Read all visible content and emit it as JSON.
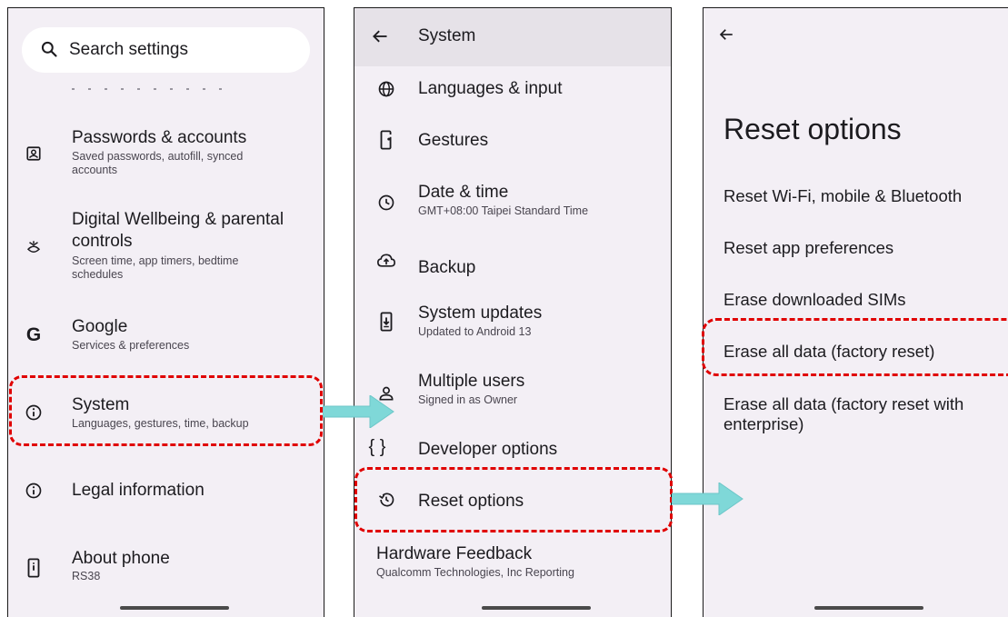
{
  "panel1": {
    "search_placeholder": "Search settings",
    "items": [
      {
        "title": "Passwords & accounts",
        "sub": "Saved passwords, autofill, synced",
        "sub2": "accounts",
        "icon": "account-box-icon"
      },
      {
        "title": "Digital Wellbeing & parental",
        "title2": "controls",
        "sub": "Screen time, app timers, bedtime",
        "sub2": "schedules",
        "icon": "wellbeing-icon"
      },
      {
        "title": "Google",
        "sub": "Services & preferences",
        "icon": "google-icon"
      },
      {
        "title": "System",
        "sub": "Languages, gestures, time, backup",
        "icon": "info-icon"
      },
      {
        "title": "Legal information",
        "icon": "info-icon"
      },
      {
        "title": "About phone",
        "sub": "RS38",
        "icon": "phone-icon"
      }
    ]
  },
  "panel2": {
    "header": "System",
    "items": [
      {
        "title": "Languages & input",
        "icon": "globe-icon"
      },
      {
        "title": "Gestures",
        "icon": "gestures-icon"
      },
      {
        "title": "Date & time",
        "sub": "GMT+08:00 Taipei Standard Time",
        "icon": "clock-icon"
      },
      {
        "title": "Backup",
        "icon": "cloud-upload-icon"
      },
      {
        "title": "System updates",
        "sub": "Updated to Android 13",
        "icon": "system-update-icon"
      },
      {
        "title": "Multiple users",
        "sub": "Signed in as Owner",
        "icon": "person-icon"
      },
      {
        "title": "Developer options",
        "icon": "braces-icon"
      },
      {
        "title": "Reset options",
        "icon": "history-icon"
      },
      {
        "title": "Hardware Feedback",
        "sub": "Qualcomm Technologies, Inc Reporting"
      }
    ]
  },
  "panel3": {
    "title": "Reset options",
    "items": [
      {
        "title": "Reset Wi-Fi, mobile & Bluetooth"
      },
      {
        "title": "Reset app preferences"
      },
      {
        "title": "Erase downloaded SIMs"
      },
      {
        "title": "Erase all data (factory reset)"
      },
      {
        "title": "Erase all data (factory reset with",
        "title2": "enterprise)"
      }
    ]
  },
  "colors": {
    "highlight": "#e00000",
    "arrow": "#7fd8d8",
    "panel_bg": "#f3eff5"
  }
}
